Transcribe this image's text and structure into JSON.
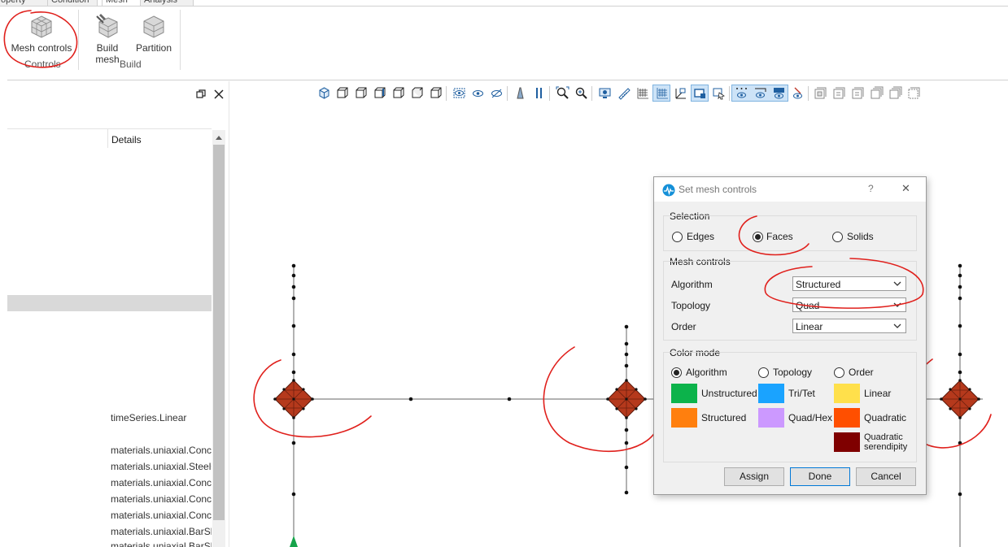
{
  "ribbon": {
    "tabs": [
      "operty",
      "Condition",
      "Mesh",
      "Analysis"
    ],
    "buttons": {
      "mesh_controls": "Mesh controls",
      "build_mesh": "Build mesh",
      "partition": "Partition"
    },
    "groups": {
      "controls": "Controls",
      "build": "Build"
    }
  },
  "left_panel": {
    "column_header": "Details",
    "rows": [
      "timeSeries.Linear",
      "materials.uniaxial.Conc",
      "materials.uniaxial.Steel0",
      "materials.uniaxial.Conc",
      "materials.uniaxial.Conc",
      "materials.uniaxial.Conc",
      "materials.uniaxial.BarSli",
      "materials.uniaxial.BarSli"
    ]
  },
  "dialog": {
    "title": "Set mesh controls",
    "help": "?",
    "close": "✕",
    "selection": {
      "label": "Selection",
      "options": [
        "Edges",
        "Faces",
        "Solids"
      ],
      "selected": "Faces"
    },
    "mesh_controls": {
      "label": "Mesh controls",
      "algorithm_label": "Algorithm",
      "algorithm_value": "Structured",
      "topology_label": "Topology",
      "topology_value": "Quad",
      "order_label": "Order",
      "order_value": "Linear"
    },
    "color_mode": {
      "label": "Color mode",
      "options": [
        "Algorithm",
        "Topology",
        "Order"
      ],
      "selected": "Algorithm",
      "legend": {
        "unstructured": "Unstructured",
        "structured": "Structured",
        "tri_tet": "Tri/Tet",
        "quad_hex": "Quad/Hex",
        "linear": "Linear",
        "quadratic": "Quadratic",
        "quadratic_serendipity": "Quadratic serendipity"
      },
      "colors": {
        "unstructured": "#0cb34b",
        "structured": "#ff7f0e",
        "tri_tet": "#1aa3ff",
        "quad_hex": "#cc99ff",
        "linear": "#ffe04b",
        "quadratic": "#ff4f00",
        "quadratic_serendipity": "#7f0000"
      }
    },
    "buttons": {
      "assign": "Assign",
      "done": "Done",
      "cancel": "Cancel"
    }
  },
  "annotation_color": "#e0201c"
}
